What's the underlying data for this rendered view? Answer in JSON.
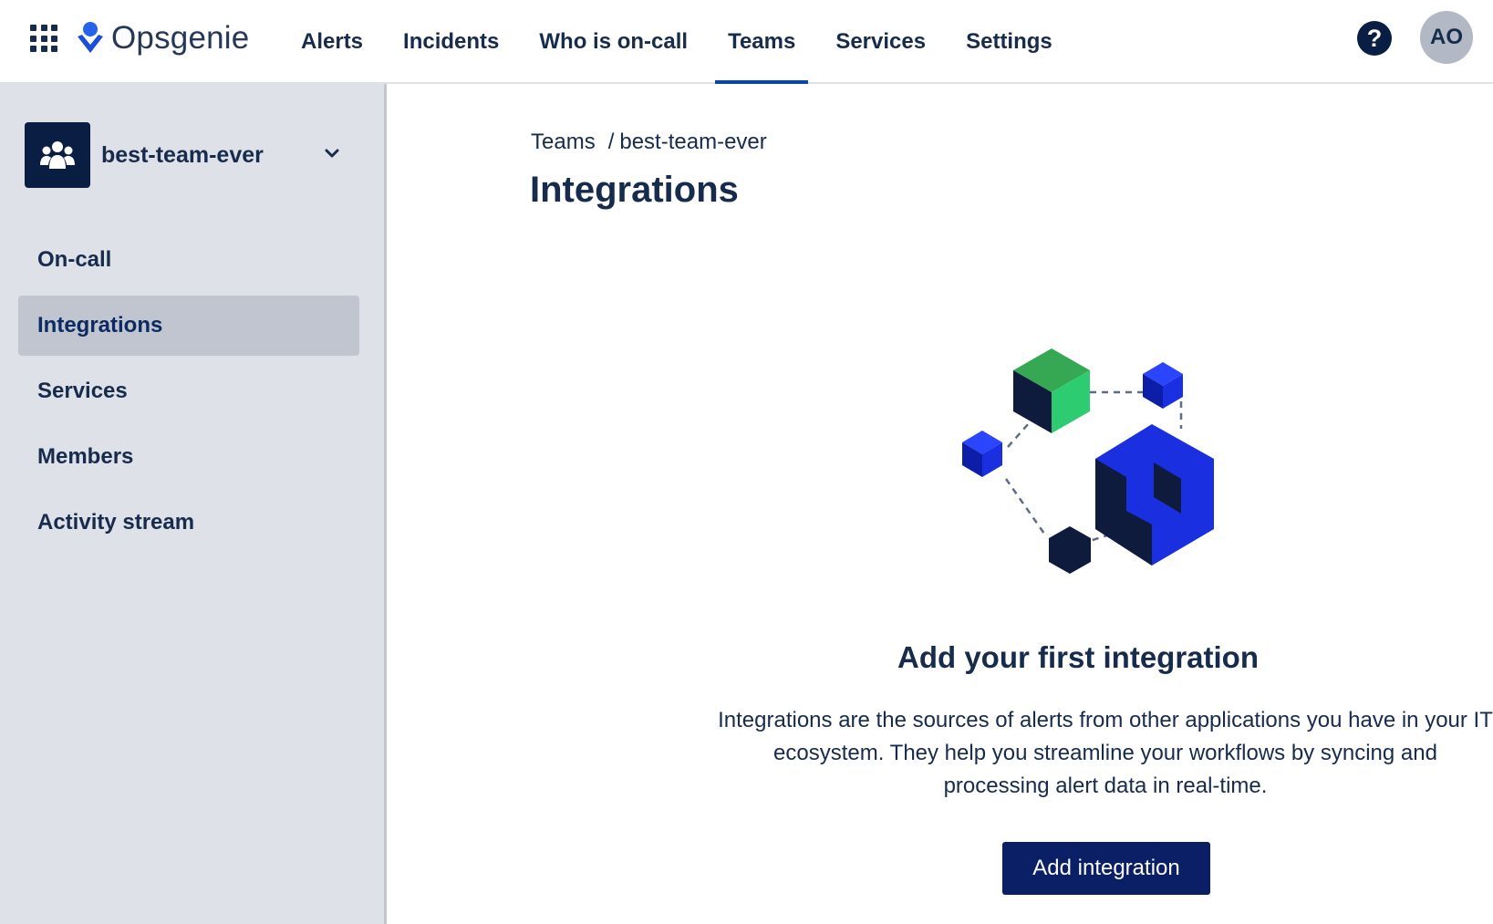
{
  "header": {
    "app_name": "Opsgenie",
    "nav": [
      {
        "label": "Alerts",
        "active": false
      },
      {
        "label": "Incidents",
        "active": false
      },
      {
        "label": "Who is on-call",
        "active": false
      },
      {
        "label": "Teams",
        "active": true
      },
      {
        "label": "Services",
        "active": false
      },
      {
        "label": "Settings",
        "active": false
      }
    ],
    "help_label": "?",
    "avatar_initials": "AO"
  },
  "sidebar": {
    "team_name": "best-team-ever",
    "items": [
      {
        "label": "On-call",
        "active": false
      },
      {
        "label": "Integrations",
        "active": true
      },
      {
        "label": "Services",
        "active": false
      },
      {
        "label": "Members",
        "active": false
      },
      {
        "label": "Activity stream",
        "active": false
      }
    ]
  },
  "main": {
    "breadcrumb": {
      "root": "Teams",
      "separator": "/",
      "current": "best-team-ever"
    },
    "title": "Integrations",
    "empty_state": {
      "heading": "Add your first integration",
      "description": "Integrations are the sources of alerts from other applications you have in your IT ecosystem. They help you streamline your workflows by syncing and processing alert data in real-time.",
      "button_label": "Add integration"
    }
  },
  "colors": {
    "brand_dark": "#172b4d",
    "primary_button": "#0b1f66",
    "sidebar_bg": "#dfe1e8",
    "accent_blue": "#1a2fe0",
    "accent_green": "#36b37e"
  },
  "icons": [
    "app-switcher-icon",
    "opsgenie-logo-icon",
    "help-icon",
    "team-icon",
    "chevron-down-icon"
  ]
}
